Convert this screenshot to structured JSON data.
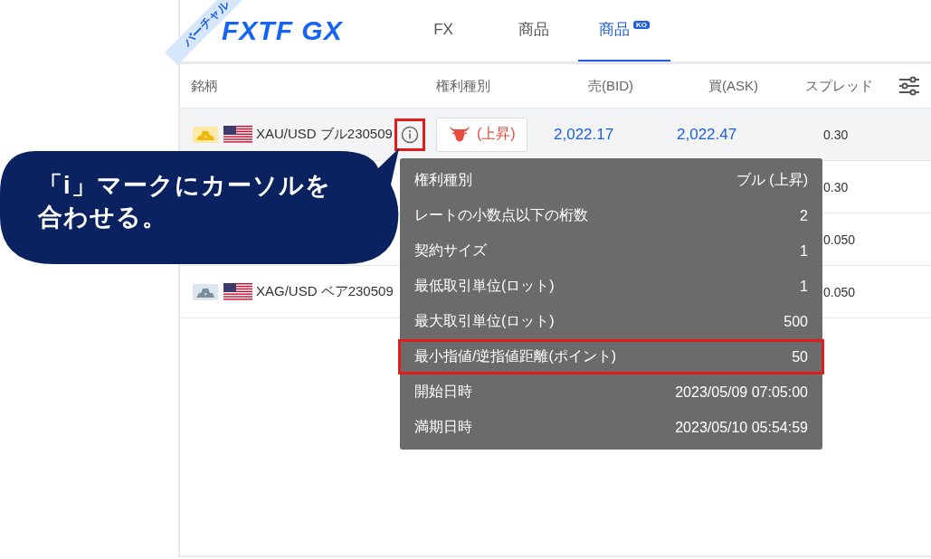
{
  "header": {
    "ribbon": "バーチャル",
    "logo": "FXTF GX",
    "tabs": [
      {
        "label": "FX",
        "selected": false
      },
      {
        "label": "商品",
        "selected": false
      },
      {
        "label": "商品",
        "badge": "KO",
        "selected": true
      }
    ]
  },
  "table": {
    "columns": [
      "銘柄",
      "権利種別",
      "売(BID)",
      "買(ASK)",
      "スプレッド"
    ],
    "rows": [
      {
        "kind": "gold",
        "name": "XAU/USD ブル230509",
        "type": {
          "kind": "bull",
          "label": "(上昇)"
        },
        "bid": "2,022.17",
        "ask": "2,022.47",
        "spread": "0.30",
        "selected": true
      },
      {
        "spread": "0.30",
        "selected": false
      },
      {
        "spread": "0.050",
        "selected": false
      },
      {
        "kind": "silver",
        "name": "XAG/USD ベア230509",
        "spread": "0.050",
        "selected": false
      }
    ]
  },
  "tooltip": {
    "rows": [
      {
        "label": "権利種別",
        "value": "ブル (上昇)",
        "highlighted": false
      },
      {
        "label": "レートの小数点以下の桁数",
        "value": "2",
        "highlighted": false
      },
      {
        "label": "契約サイズ",
        "value": "1",
        "highlighted": false
      },
      {
        "label": "最低取引単位(ロット)",
        "value": "1",
        "highlighted": false
      },
      {
        "label": "最大取引単位(ロット)",
        "value": "500",
        "highlighted": false
      },
      {
        "label": "最小指値/逆指値距離(ポイント)",
        "value": "50",
        "highlighted": true
      },
      {
        "label": "開始日時",
        "value": "2023/05/09 07:05:00",
        "highlighted": false
      },
      {
        "label": "満期日時",
        "value": "2023/05/10 05:54:59",
        "highlighted": false
      }
    ]
  },
  "callout": {
    "lines": [
      "「i」マークにカーソルを",
      "合わせる。"
    ]
  }
}
